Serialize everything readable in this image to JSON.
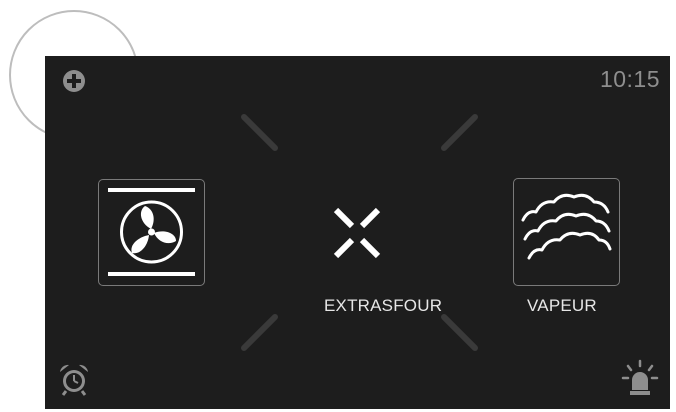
{
  "status_bar": {
    "time": "10:15"
  },
  "modes": [
    {
      "id": "fan-oven",
      "label": "",
      "icon": "fan-oven-icon"
    },
    {
      "id": "extrasfour",
      "label": "EXTRASFOUR",
      "icon": "extrasfour-cross-icon"
    },
    {
      "id": "vapeur",
      "label": "VAPEUR",
      "icon": "steam-icon"
    }
  ],
  "icons": {
    "add": "plus-circle-icon",
    "timer": "alarm-clock-icon",
    "light": "oven-light-icon"
  },
  "colors": {
    "screen_background": "#1d1d1d",
    "icon_gray": "#8e8e8e",
    "icon_white": "#ffffff",
    "highlight_ring": "#bdbdbd"
  }
}
